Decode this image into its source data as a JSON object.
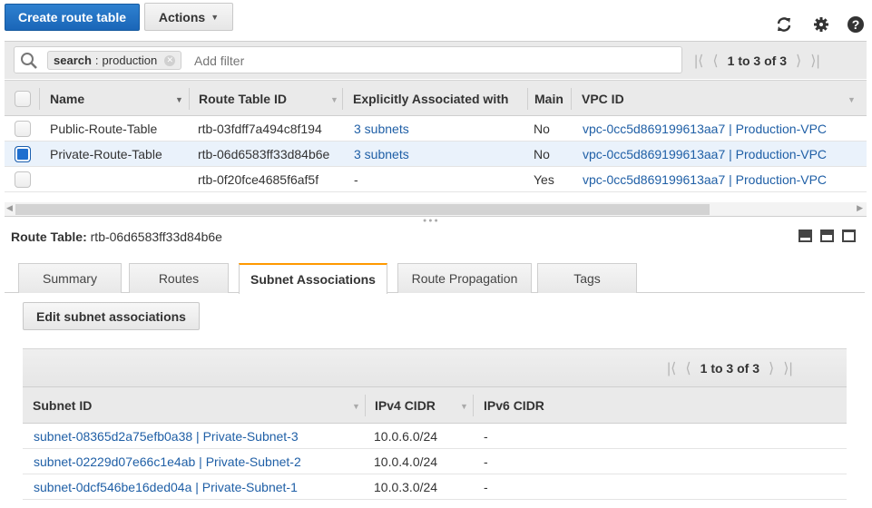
{
  "toolbar": {
    "create_label": "Create route table",
    "actions_label": "Actions",
    "icons": [
      "refresh-icon",
      "gear-icon",
      "help-icon"
    ]
  },
  "filter": {
    "token_key": "search",
    "token_sep": " : ",
    "token_value": "production",
    "placeholder": "Add filter",
    "pager_text": "1 to 3 of 3"
  },
  "route_tables": {
    "columns": [
      "Name",
      "Route Table ID",
      "Explicitly Associated with",
      "Main",
      "VPC ID"
    ],
    "rows": [
      {
        "name": "Public-Route-Table",
        "id": "rtb-03fdff7a494c8f194",
        "assoc": "3 subnets",
        "main": "No",
        "vpc": "vpc-0cc5d869199613aa7 | Production-VPC",
        "selected": false
      },
      {
        "name": "Private-Route-Table",
        "id": "rtb-06d6583ff33d84b6e",
        "assoc": "3 subnets",
        "main": "No",
        "vpc": "vpc-0cc5d869199613aa7 | Production-VPC",
        "selected": true
      },
      {
        "name": "",
        "id": "rtb-0f20fce4685f6af5f",
        "assoc": "-",
        "main": "Yes",
        "vpc": "vpc-0cc5d869199613aa7 | Production-VPC",
        "selected": false
      }
    ]
  },
  "detail": {
    "label": "Route Table:",
    "value": "rtb-06d6583ff33d84b6e",
    "tabs": [
      "Summary",
      "Routes",
      "Subnet Associations",
      "Route Propagation",
      "Tags"
    ],
    "active_tab": "Subnet Associations",
    "edit_button": "Edit subnet associations"
  },
  "subnets": {
    "pager_text": "1 to 3 of 3",
    "columns": [
      "Subnet ID",
      "IPv4 CIDR",
      "IPv6 CIDR"
    ],
    "rows": [
      {
        "subnet": "subnet-08365d2a75efb0a38 | Private-Subnet-3",
        "ipv4": "10.0.6.0/24",
        "ipv6": "-"
      },
      {
        "subnet": "subnet-02229d07e66c1e4ab | Private-Subnet-2",
        "ipv4": "10.0.4.0/24",
        "ipv6": "-"
      },
      {
        "subnet": "subnet-0dcf546be16ded04a | Private-Subnet-1",
        "ipv4": "10.0.3.0/24",
        "ipv6": "-"
      }
    ]
  },
  "colors": {
    "primary": "#1a66b8",
    "link": "#1f5fa6",
    "active_tab_accent": "#ff9900",
    "selected_row": "#eaf2fb"
  }
}
